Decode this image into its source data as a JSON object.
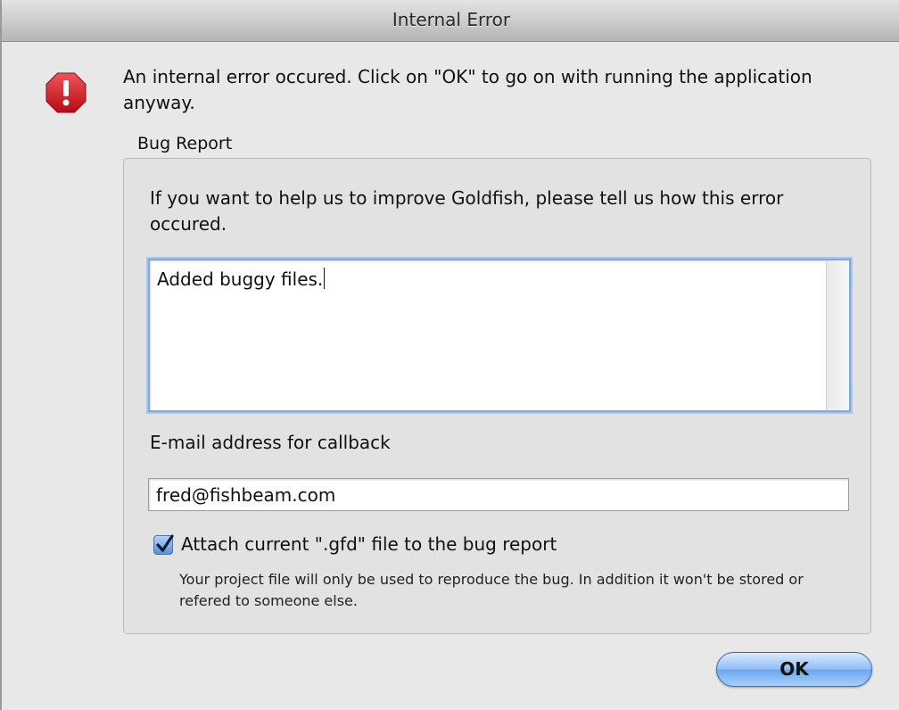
{
  "window": {
    "title": "Internal Error"
  },
  "message": {
    "icon": "error-octagon-icon",
    "text": "An internal error occured. Click on \"OK\" to go on with running the application anyway."
  },
  "bug_report": {
    "group_label": "Bug Report",
    "help_text": "If you want to help us to improve Goldfish, please tell us how this error occured.",
    "description_value": "Added buggy files.",
    "email_label": "E-mail address for callback",
    "email_value": "fred@fishbeam.com",
    "attach_checked": true,
    "attach_label": "Attach current \".gfd\" file to the bug report",
    "note": "Your project file will only be used to reproduce the bug. In addition it won't be stored or refered to someone else."
  },
  "buttons": {
    "ok_label": "OK"
  },
  "colors": {
    "error_red": "#d9141b",
    "focus_blue": "#7fa8de",
    "button_blue": "#6aa6ee"
  }
}
